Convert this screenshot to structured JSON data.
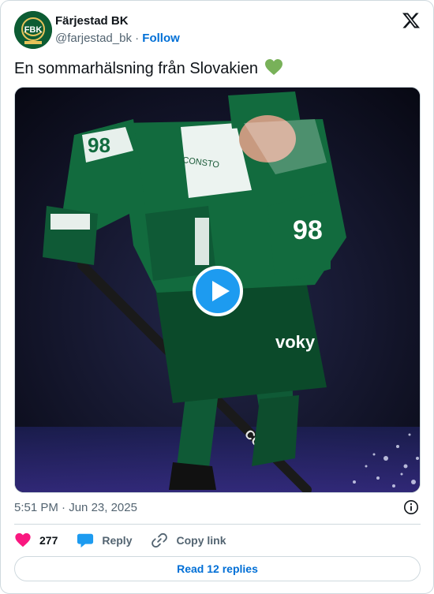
{
  "author": {
    "display_name": "Färjestad BK",
    "handle": "@farjestad_bk",
    "separator": "·",
    "follow_label": "Follow",
    "logo_text": "FBK"
  },
  "tweet": {
    "text": "En sommarhälsning från Slovakien",
    "emoji": "green-heart"
  },
  "media": {
    "type": "video",
    "jersey_number": "98",
    "sponsor_text": "voky",
    "stick_text": "CCM",
    "sleeve_text": "CONSTO"
  },
  "meta": {
    "time": "5:51 PM",
    "separator": "·",
    "date": "Jun 23, 2025"
  },
  "actions": {
    "likes": "277",
    "reply_label": "Reply",
    "copy_link_label": "Copy link"
  },
  "footer": {
    "read_replies_label": "Read 12 replies"
  },
  "colors": {
    "brand_green": "#0d5c33",
    "link_blue": "#006fd6",
    "like_pink": "#f91880",
    "reply_blue": "#1d9bf0",
    "muted": "#536471"
  }
}
